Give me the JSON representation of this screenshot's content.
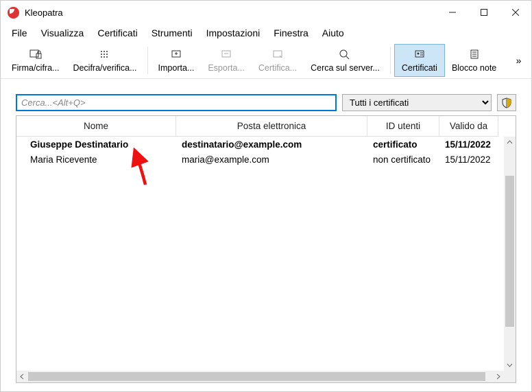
{
  "window": {
    "title": "Kleopatra"
  },
  "menu": {
    "items": [
      "File",
      "Visualizza",
      "Certificati",
      "Strumenti",
      "Impostazioni",
      "Finestra",
      "Aiuto"
    ]
  },
  "toolbar": {
    "sign": {
      "label": "Firma/cifra..."
    },
    "decrypt": {
      "label": "Decifra/verifica..."
    },
    "import": {
      "label": "Importa..."
    },
    "export": {
      "label": "Esporta..."
    },
    "certify": {
      "label": "Certifica..."
    },
    "lookup": {
      "label": "Cerca sul server..."
    },
    "certs": {
      "label": "Certificati"
    },
    "notes": {
      "label": "Blocco note"
    },
    "overflow": "»"
  },
  "search": {
    "placeholder": "Cerca...<Alt+Q>"
  },
  "filter": {
    "selected": "Tutti i certificati"
  },
  "table": {
    "headers": {
      "name": "Nome",
      "email": "Posta elettronica",
      "uid": "ID utenti",
      "valid": "Valido da"
    },
    "rows": [
      {
        "name": "Giuseppe Destinatario",
        "email": "destinatario@example.com",
        "uid": "certificato",
        "valid": "15/11/2022",
        "bold": true
      },
      {
        "name": "Maria Ricevente",
        "email": "maria@example.com",
        "uid": "non certificato",
        "valid": "15/11/2022",
        "bold": false
      }
    ]
  }
}
